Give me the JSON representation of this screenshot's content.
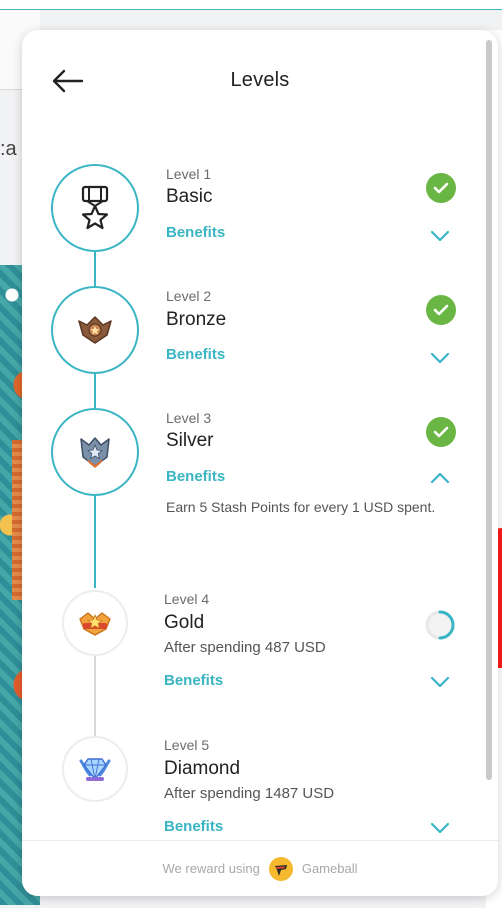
{
  "header": {
    "title": "Levels",
    "back_icon": "arrow-left-icon"
  },
  "levels": [
    {
      "number": "Level 1",
      "name": "Basic",
      "benefits_label": "Benefits",
      "status": "achieved",
      "icon": "basic-medal-icon",
      "expanded": false
    },
    {
      "number": "Level 2",
      "name": "Bronze",
      "benefits_label": "Benefits",
      "status": "achieved",
      "icon": "bronze-badge-icon",
      "expanded": false
    },
    {
      "number": "Level 3",
      "name": "Silver",
      "benefits_label": "Benefits",
      "status": "achieved",
      "icon": "silver-badge-icon",
      "expanded": true,
      "benefit_text": "Earn 5 Stash Points for every 1 USD spent."
    },
    {
      "number": "Level 4",
      "name": "Gold",
      "requirement": "After spending 487 USD",
      "benefits_label": "Benefits",
      "status": "in-progress",
      "icon": "gold-badge-icon",
      "expanded": false
    },
    {
      "number": "Level 5",
      "name": "Diamond",
      "requirement": "After spending 1487 USD",
      "benefits_label": "Benefits",
      "status": "locked",
      "icon": "diamond-badge-icon",
      "expanded": false
    }
  ],
  "footer": {
    "text_before": "We reward using",
    "brand": "Gameball",
    "logo_icon": "gameball-logo-icon"
  },
  "colors": {
    "accent": "#3ab5c4",
    "check": "#6ab645",
    "title_text": "#222222",
    "secondary_text": "#6b6b6b"
  }
}
